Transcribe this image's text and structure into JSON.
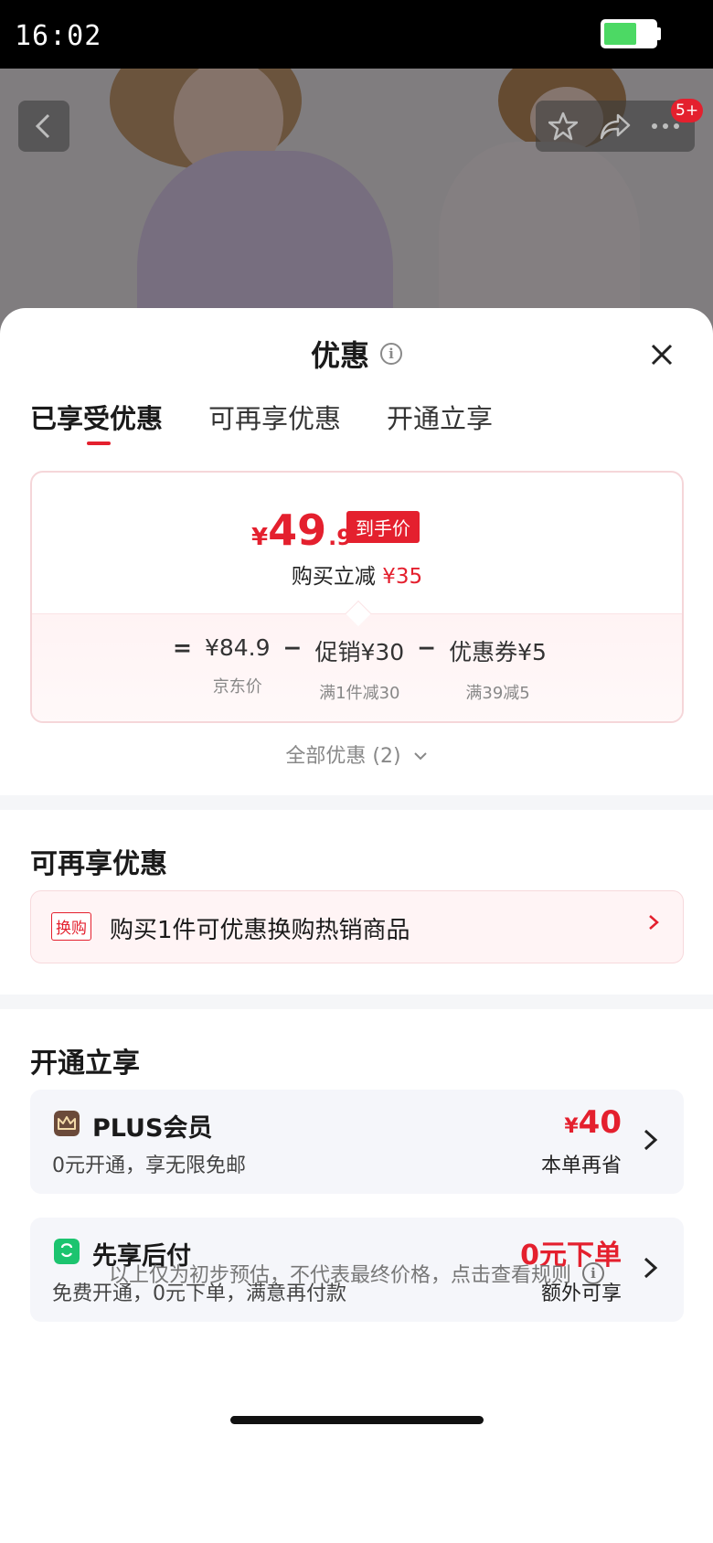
{
  "status_bar": {
    "time": "16:02"
  },
  "product_header": {
    "cart_badge": "5+"
  },
  "sheet": {
    "title": "优惠",
    "tabs": [
      {
        "label": "已享受优惠",
        "active": true
      },
      {
        "label": "可再享优惠",
        "active": false
      },
      {
        "label": "开通立享",
        "active": false
      }
    ]
  },
  "price_card": {
    "final_price_symbol": "¥",
    "final_price_integer": "49",
    "final_price_decimal": ".9",
    "final_price_tag": "到手价",
    "instant_cut_label": "购买立减",
    "instant_cut_amount": "¥35",
    "formula": {
      "equals": "=",
      "base_price": "¥84.9",
      "base_label": "京东价",
      "minus": "−",
      "promo_value": "促销¥30",
      "promo_label": "满1件减30",
      "coupon_value": "优惠券¥5",
      "coupon_label": "满39减5"
    }
  },
  "all_offers": "全部优惠 (2)",
  "more_offers": {
    "title": "可再享优惠",
    "exchange": {
      "tag": "换购",
      "text": "购买1件可优惠换购热销商品"
    }
  },
  "activate": {
    "title": "开通立享",
    "plus": {
      "title": "PLUS会员",
      "subtitle": "0元开通，享无限免邮",
      "value_symbol": "¥",
      "value": "40",
      "note": "本单再省"
    },
    "pay_later": {
      "title": "先享后付",
      "subtitle": "免费开通，0元下单，满意再付款",
      "value": "0元下单",
      "note": "额外可享"
    }
  },
  "disclaimer": "以上仅为初步预估，不代表最终价格，点击查看规则",
  "colors": {
    "accent": "#e4202e",
    "plus_icon": "#6b4a3a",
    "pay_later_icon": "#1cc46f"
  }
}
